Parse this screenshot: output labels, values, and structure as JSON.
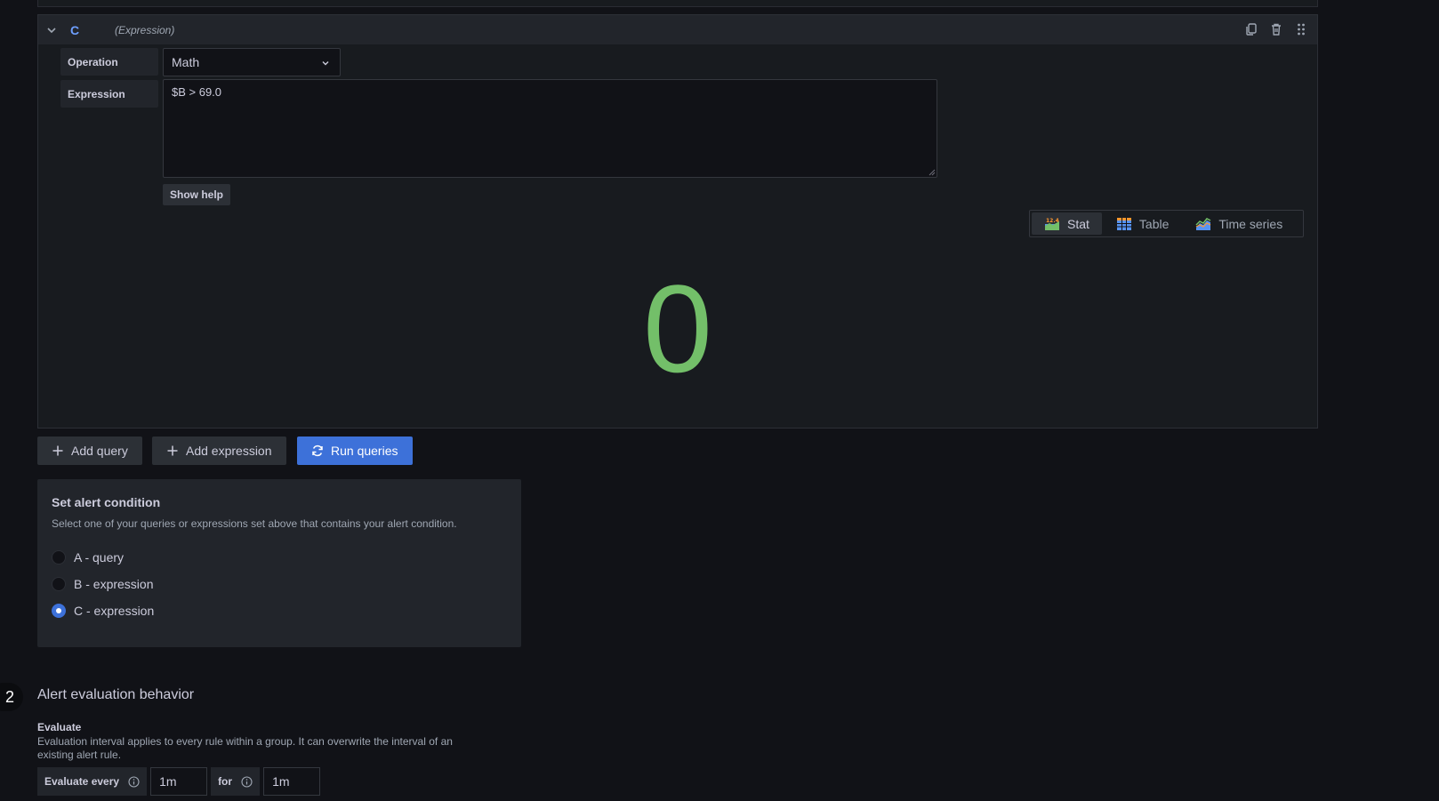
{
  "query": {
    "ref_id": "C",
    "type_label": "(Expression)",
    "operation_label": "Operation",
    "operation_value": "Math",
    "expression_label": "Expression",
    "expression_value": "$B > 69.0",
    "show_help_label": "Show help",
    "viz_options": [
      {
        "label": "Stat",
        "icon": "stat-icon",
        "active": true
      },
      {
        "label": "Table",
        "icon": "table-icon",
        "active": false
      },
      {
        "label": "Time series",
        "icon": "timeseries-icon",
        "active": false
      }
    ],
    "stat_value": "0",
    "stat_color": "#73bf69"
  },
  "actions": {
    "add_query": "Add query",
    "add_expression": "Add expression",
    "run_queries": "Run queries"
  },
  "condition": {
    "title": "Set alert condition",
    "description": "Select one of your queries or expressions set above that contains your alert condition.",
    "options": [
      {
        "label": "A - query",
        "checked": false
      },
      {
        "label": "B - expression",
        "checked": false
      },
      {
        "label": "C - expression",
        "checked": true
      }
    ]
  },
  "evaluation": {
    "step_number": "2",
    "section_title": "Alert evaluation behavior",
    "evaluate_title": "Evaluate",
    "evaluate_desc": "Evaluation interval applies to every rule within a group. It can overwrite the interval of an existing alert rule.",
    "evaluate_every_label": "Evaluate every",
    "evaluate_every_value": "1m",
    "for_label": "for",
    "for_value": "1m"
  },
  "colors": {
    "accent": "#3d71d9",
    "ref_id": "#6e9fff",
    "background": "#111217"
  }
}
